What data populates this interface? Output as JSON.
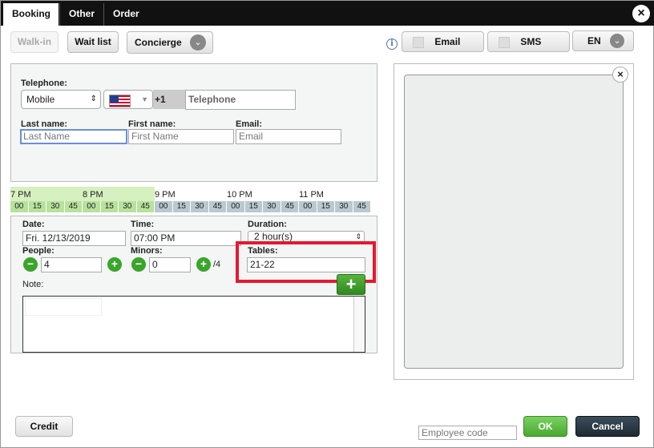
{
  "tabs": [
    "Booking",
    "Other",
    "Order"
  ],
  "toolbar": {
    "walkin": "Walk-in",
    "waitlist": "Wait list",
    "concierge": "Concierge",
    "email": "Email",
    "sms": "SMS",
    "lang": "EN"
  },
  "contact": {
    "telephone_label": "Telephone:",
    "phone_type": "Mobile",
    "country_code": "+1",
    "telephone_placeholder": "Telephone",
    "lastname_label": "Last name:",
    "lastname_placeholder": "Last Name",
    "firstname_label": "First name:",
    "firstname_placeholder": "First Name",
    "email_label": "Email:",
    "email_placeholder": "Email"
  },
  "timeline": {
    "hours": [
      "7 PM",
      "8 PM",
      "9 PM",
      "10 PM",
      "11 PM"
    ],
    "slots": [
      "00",
      "15",
      "30",
      "45",
      "00",
      "15",
      "30",
      "45",
      "00",
      "15",
      "30",
      "45",
      "00",
      "15",
      "30",
      "45",
      "00",
      "15",
      "30",
      "45"
    ],
    "green_count": 8
  },
  "booking": {
    "date_label": "Date:",
    "date_value": "Fri. 12/13/2019",
    "time_label": "Time:",
    "time_value": "07:00 PM",
    "duration_label": "Duration:",
    "duration_value": "2 hour(s)",
    "people_label": "People:",
    "people_value": "4",
    "minors_label": "Minors:",
    "minors_value": "0",
    "minors_suffix": "/4",
    "tables_label": "Tables:",
    "tables_value": "21-22",
    "note_label": "Note:"
  },
  "footer": {
    "credit": "Credit",
    "employee_placeholder": "Employee code",
    "ok": "OK",
    "cancel": "Cancel"
  },
  "icons": {
    "close": "×",
    "chevron": "⌄",
    "minus": "−",
    "plus": "+",
    "info": "i",
    "sort": "⇕"
  },
  "colors": {
    "accent_green": "#3aa52c",
    "highlight_red": "#e5192f",
    "timeline_green": "#b7e29c",
    "timeline_blue": "#b8c9cf"
  }
}
